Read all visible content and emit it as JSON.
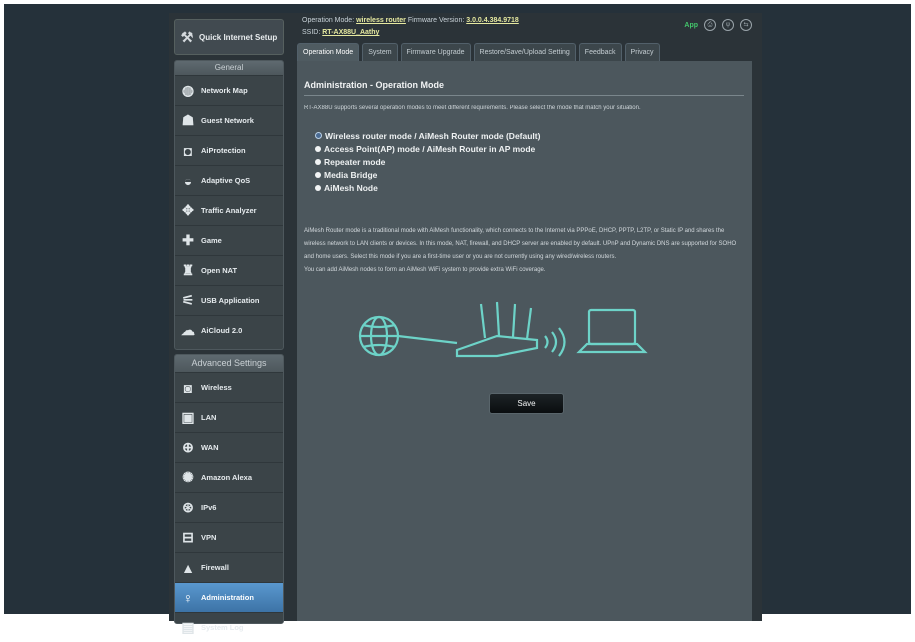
{
  "sidebar": {
    "quick_setup": "Quick Internet Setup",
    "general_header": "General",
    "general_items": [
      {
        "label": "Network Map",
        "icon": "globe-icon"
      },
      {
        "label": "Guest Network",
        "icon": "guest-network-icon"
      },
      {
        "label": "AiProtection",
        "icon": "shield-icon"
      },
      {
        "label": "Adaptive QoS",
        "icon": "qos-icon"
      },
      {
        "label": "Traffic Analyzer",
        "icon": "analyzer-icon"
      },
      {
        "label": "Game",
        "icon": "gamepad-icon"
      },
      {
        "label": "Open NAT",
        "icon": "open-nat-icon"
      },
      {
        "label": "USB Application",
        "icon": "usb-icon"
      },
      {
        "label": "AiCloud 2.0",
        "icon": "cloud-icon"
      }
    ],
    "advanced_header": "Advanced Settings",
    "advanced_items": [
      {
        "label": "Wireless",
        "icon": "wireless-icon"
      },
      {
        "label": "LAN",
        "icon": "lan-icon"
      },
      {
        "label": "WAN",
        "icon": "wan-icon"
      },
      {
        "label": "Amazon Alexa",
        "icon": "alexa-icon"
      },
      {
        "label": "IPv6",
        "icon": "ipv6-icon"
      },
      {
        "label": "VPN",
        "icon": "vpn-icon"
      },
      {
        "label": "Firewall",
        "icon": "firewall-icon"
      },
      {
        "label": "Administration",
        "icon": "admin-icon",
        "active": true
      },
      {
        "label": "System Log",
        "icon": "log-icon"
      }
    ]
  },
  "banner": {
    "operation_mode_label": "Operation Mode:",
    "operation_mode_value": "wireless router",
    "firmware_label": "Firmware Version:",
    "firmware_value": "3.0.0.4.384.9718",
    "ssid_label": "SSID:",
    "ssid_value": "RT-AX88U_Aathy",
    "app_status": "App"
  },
  "tabs": [
    "Operation Mode",
    "System",
    "Firmware Upgrade",
    "Restore/Save/Upload Setting",
    "Feedback",
    "Privacy"
  ],
  "content": {
    "title": "Administration - Operation Mode",
    "description": "RT-AX88U supports several operation modes to meet different requirements. Please select the mode that match your situation.",
    "modes": [
      "Wireless router mode / AiMesh Router mode (Default)",
      "Access Point(AP) mode / AiMesh Router in AP mode",
      "Repeater mode",
      "Media Bridge",
      "AiMesh Node"
    ],
    "selected_mode_index": 0,
    "paragraph_1": "AiMesh Router mode is a traditional mode with AiMesh functionality, which connects to the Internet via PPPoE, DHCP, PPTP, L2TP, or Static IP and shares the wireless network to LAN clients or devices. In this mode, NAT, firewall, and DHCP server are enabled by default. UPnP and Dynamic DNS are supported for SOHO and home users. Select this mode if you are a first-time user or you are not currently using any wired/wireless routers.",
    "paragraph_2": "You can add AiMesh nodes to form an AiMesh WiFi system to provide extra WiFi coverage.",
    "save_label": "Save"
  },
  "colors": {
    "page_bg": "#25313a",
    "content_bg": "#4c575d",
    "active_item": "#4a86bd",
    "illustration": "#6dd3c8"
  }
}
